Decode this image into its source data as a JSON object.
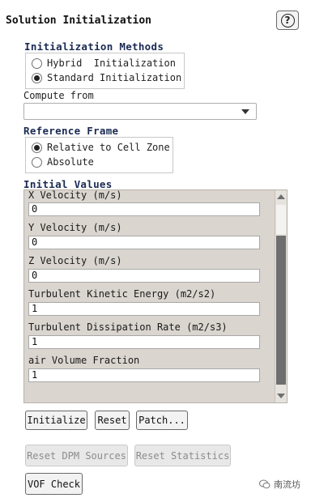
{
  "panel": {
    "title": "Solution Initialization",
    "help_glyph": "?"
  },
  "init_methods": {
    "label": "Initialization Methods",
    "options": [
      {
        "label": "Hybrid  Initialization",
        "selected": false
      },
      {
        "label": "Standard Initialization",
        "selected": true
      }
    ]
  },
  "compute_from": {
    "label": "Compute from",
    "value": ""
  },
  "reference_frame": {
    "label": "Reference Frame",
    "options": [
      {
        "label": "Relative to Cell Zone",
        "selected": true
      },
      {
        "label": "Absolute",
        "selected": false
      }
    ]
  },
  "initial_values": {
    "label": "Initial Values",
    "fields": [
      {
        "label": "X Velocity (m/s)",
        "value": "0"
      },
      {
        "label": "Y Velocity (m/s)",
        "value": "0"
      },
      {
        "label": "Z Velocity (m/s)",
        "value": "0"
      },
      {
        "label": "Turbulent Kinetic Energy (m2/s2)",
        "value": "1"
      },
      {
        "label": "Turbulent Dissipation Rate (m2/s3)",
        "value": "1"
      },
      {
        "label": "air Volume Fraction",
        "value": "1"
      }
    ]
  },
  "buttons": {
    "initialize": "Initialize",
    "reset": "Reset",
    "patch": "Patch...",
    "reset_dpm": "Reset DPM Sources",
    "reset_stats": "Reset Statistics",
    "vof_check": "VOF Check"
  },
  "watermark": {
    "text": "南流坊"
  },
  "colors": {
    "group_label": "#1a2a52",
    "values_background": "#dad5cf"
  }
}
